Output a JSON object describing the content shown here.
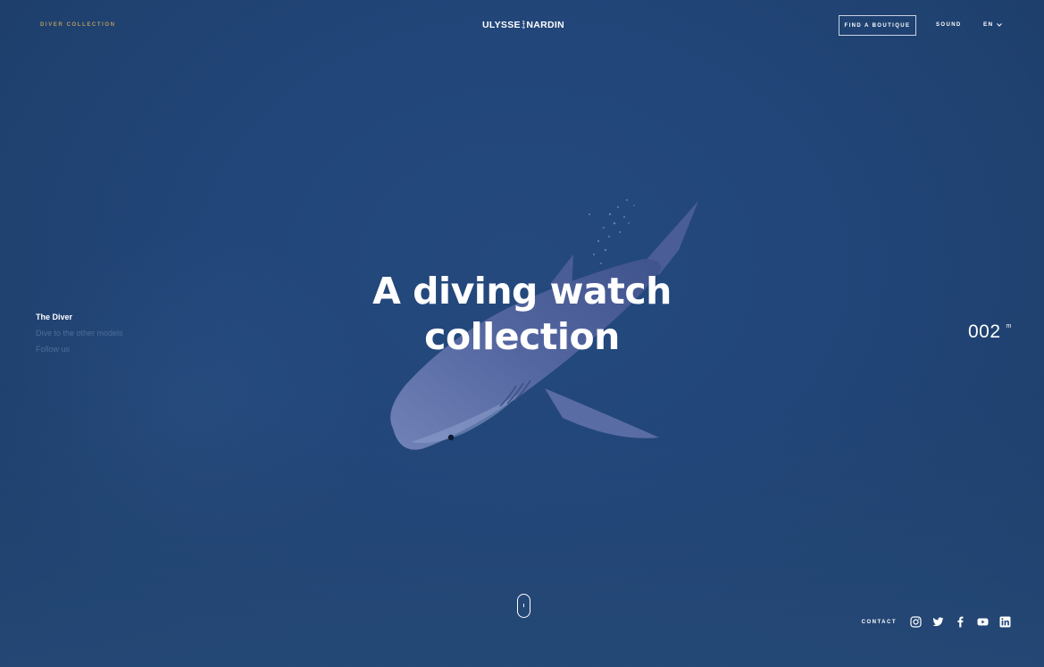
{
  "header": {
    "collection_label": "DIVER COLLECTION",
    "logo_left": "ULYSSE",
    "logo_right": "NARDIN",
    "find_boutique": "FIND A BOUTIQUE",
    "sound": "SOUND",
    "language": "EN"
  },
  "sidenav": {
    "items": [
      {
        "label": "The Diver",
        "active": true
      },
      {
        "label": "Dive to the other models",
        "active": false
      },
      {
        "label": "Follow us",
        "active": false
      }
    ]
  },
  "hero": {
    "line1": "A diving watch",
    "line2": "collection"
  },
  "depth": {
    "value": "002",
    "unit": "m"
  },
  "footer": {
    "contact": "CONTACT",
    "social": [
      "instagram-icon",
      "twitter-icon",
      "facebook-icon",
      "youtube-icon",
      "linkedin-icon"
    ]
  },
  "colors": {
    "ocean": "#22467a",
    "accent_gold": "#b59a5e",
    "nav_inactive": "#4b6d98",
    "shark": "#5d6ea4"
  }
}
